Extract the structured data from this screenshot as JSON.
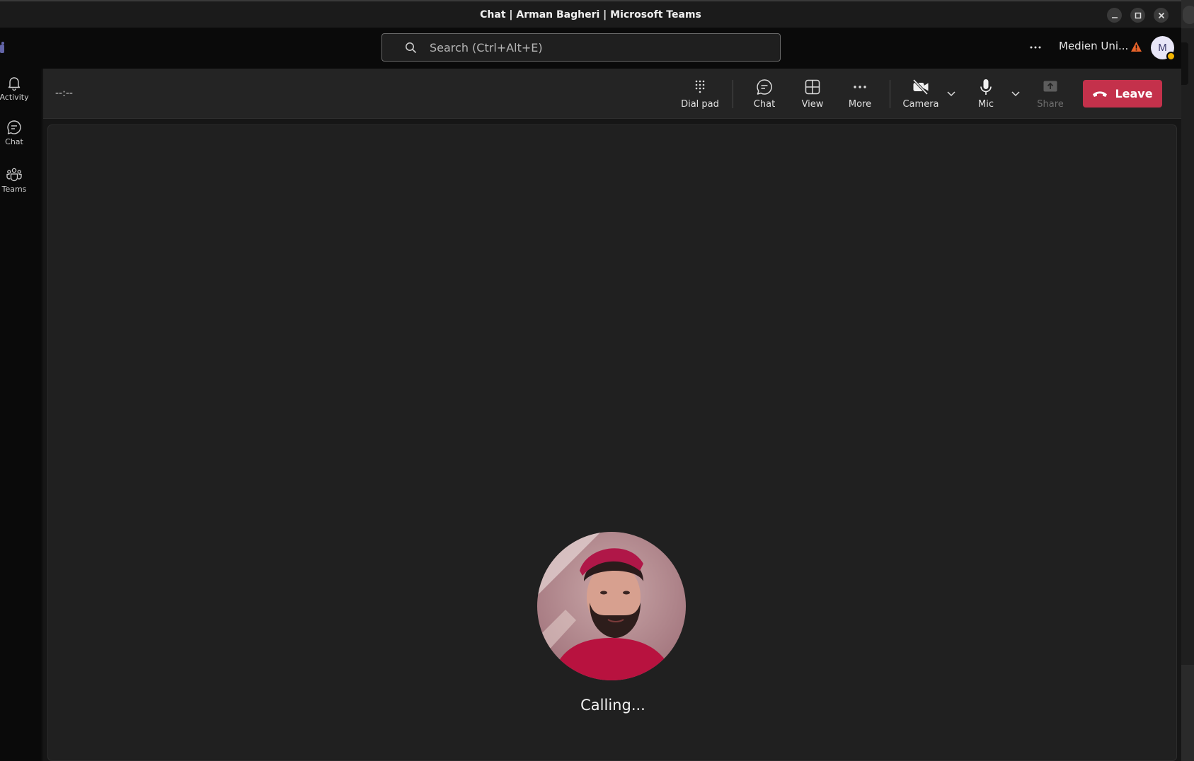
{
  "window": {
    "title": "Chat | Arman Bagheri | Microsoft Teams"
  },
  "topbar": {
    "search_placeholder": "Search (Ctrl+Alt+E)",
    "org_name": "Medien Uni...",
    "avatar_initial": "M"
  },
  "rail": {
    "items": [
      {
        "label": "Activity",
        "icon": "bell-icon"
      },
      {
        "label": "Chat",
        "icon": "chat-bubble-icon"
      },
      {
        "label": "Teams",
        "icon": "teams-icon"
      }
    ]
  },
  "call": {
    "timer": "--:--",
    "toolbar": {
      "dialpad": "Dial pad",
      "chat": "Chat",
      "view": "View",
      "more": "More",
      "camera": "Camera",
      "mic": "Mic",
      "share": "Share",
      "leave": "Leave"
    },
    "status": "Calling..."
  },
  "colors": {
    "leave": "#c4314b",
    "presence_away": "#f2b400",
    "warning": "#e8632a"
  }
}
